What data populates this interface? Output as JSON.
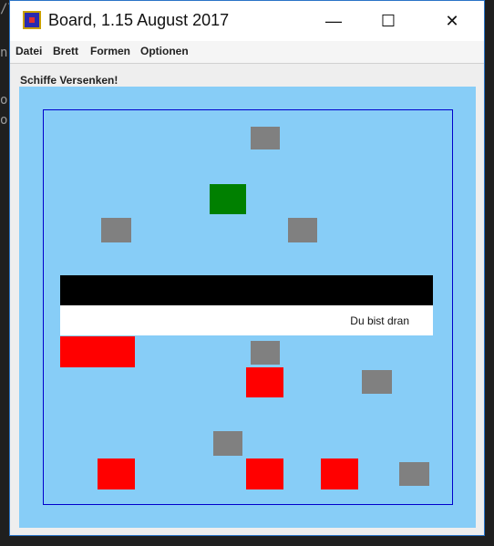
{
  "background": {
    "glyphs": [
      "/\\",
      "n",
      "o",
      "o"
    ]
  },
  "window": {
    "title": "Board, 1.15 August 2017",
    "app_icon": "board-app-icon",
    "controls": {
      "minimize": "—",
      "maximize": "☐",
      "close": "✕"
    }
  },
  "menu": {
    "items": [
      "Datei",
      "Brett",
      "Formen",
      "Optionen"
    ]
  },
  "game": {
    "heading": "Schiffe Versenken!",
    "status": "Du bist dran",
    "colors": {
      "water": "#87cdf7",
      "frame": "#0000cc",
      "miss": "#808080",
      "hit": "#ff0000",
      "player": "#008000",
      "bar_top": "#000000",
      "bar_bottom": "#ffffff"
    }
  }
}
